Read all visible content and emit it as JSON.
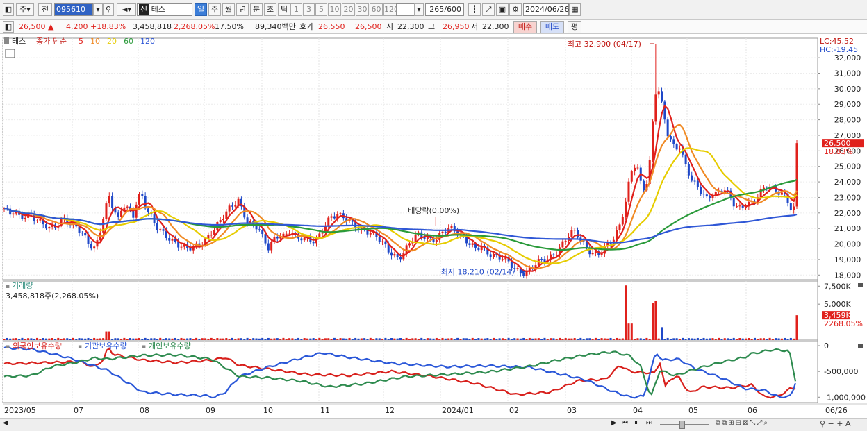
{
  "toolbar": {
    "market": "주",
    "prev_label": "전",
    "code": "095610",
    "stock_name": "테스",
    "stock_badge": "신",
    "periods": [
      "일",
      "주",
      "월",
      "년",
      "분",
      "초",
      "틱"
    ],
    "selected_period": "일",
    "numbers": [
      "1",
      "3",
      "5",
      "10",
      "20",
      "30",
      "60",
      "120"
    ],
    "count": "265",
    "count_total": "/600",
    "date": "2024/06/26"
  },
  "quote": {
    "price": "26,500",
    "change": "4,200",
    "change_pct": "+18.83%",
    "volume": "3,458,818",
    "volume_pct": "2,268.05%",
    "turnover": "17.50%",
    "amount": "89,340백만",
    "bid_label": "호가",
    "ask": "26,550",
    "bid": "26,500",
    "open_label": "시",
    "open": "22,300",
    "high_label": "고",
    "high": "26,950",
    "low_label": "저",
    "low": "22,300",
    "buy_label": "매수",
    "sell_label": "매도",
    "eval_label": "평"
  },
  "price_panel": {
    "stock_label": "테스",
    "legend_title": "종가 단순",
    "ma": [
      {
        "period": "5",
        "color": "#e0211c"
      },
      {
        "period": "10",
        "color": "#f08a24"
      },
      {
        "period": "20",
        "color": "#e6cc00"
      },
      {
        "period": "60",
        "color": "#2a9a3a"
      },
      {
        "period": "120",
        "color": "#2f57d6"
      }
    ],
    "lc": "LC:45.52",
    "hc": "HC:-19.45",
    "high_annotation": "최고 32,900 (04/17)",
    "low_annotation": "최저 18,210 (02/14)",
    "dividend_annotation": "배당락(0.00%)",
    "last_price_tag": "26,500",
    "last_pct_tag": "18.83%",
    "y_ticks": [
      "32,000",
      "31,000",
      "30,000",
      "29,000",
      "28,000",
      "27,000",
      "26,000",
      "25,000",
      "24,000",
      "23,000",
      "22,000",
      "21,000",
      "20,000",
      "19,000",
      "18,000"
    ]
  },
  "volume_panel": {
    "title": "거래량",
    "value": "3,458,818주(2,268.05%)",
    "y_ticks": [
      "7,500K",
      "5,000K"
    ],
    "last_tag": "3,459K",
    "last_pct": "2268.05%"
  },
  "holdings_panel": {
    "series": [
      {
        "name": "외국인보유수량",
        "color": "#d8201c"
      },
      {
        "name": "기관보유수량",
        "color": "#2a57d8"
      },
      {
        "name": "개인보유수량",
        "color": "#2e8b4f"
      }
    ],
    "y_ticks": [
      "0",
      "-500,000",
      "-1,000,000"
    ]
  },
  "x_axis": [
    "2023/05",
    "07",
    "08",
    "09",
    "10",
    "11",
    "12",
    "2024/01",
    "02",
    "03",
    "04",
    "05",
    "06"
  ],
  "x_axis_right": "06/26",
  "chart_data": {
    "type": "candlestick",
    "ylim": [
      17700,
      32900
    ],
    "high": {
      "value": 32900,
      "date": "04/17"
    },
    "low": {
      "value": 18210,
      "date": "02/14"
    },
    "last": 26500,
    "price_path": [
      [
        0,
        22300
      ],
      [
        8,
        21800
      ],
      [
        15,
        22100
      ],
      [
        22,
        21700
      ],
      [
        30,
        21900
      ],
      [
        38,
        22000
      ],
      [
        45,
        21600
      ],
      [
        55,
        21200
      ],
      [
        65,
        21000
      ],
      [
        75,
        21300
      ],
      [
        85,
        21700
      ],
      [
        95,
        21200
      ],
      [
        105,
        21000
      ],
      [
        115,
        20600
      ],
      [
        125,
        20000
      ],
      [
        132,
        19700
      ],
      [
        140,
        21000
      ],
      [
        148,
        22400
      ],
      [
        152,
        23000
      ],
      [
        158,
        22300
      ],
      [
        165,
        21700
      ],
      [
        172,
        22700
      ],
      [
        180,
        22200
      ],
      [
        186,
        21600
      ],
      [
        192,
        22700
      ],
      [
        198,
        23200
      ],
      [
        205,
        22400
      ],
      [
        212,
        21900
      ],
      [
        220,
        21200
      ],
      [
        228,
        20700
      ],
      [
        236,
        20300
      ],
      [
        245,
        20100
      ],
      [
        255,
        20000
      ],
      [
        265,
        19800
      ],
      [
        275,
        19700
      ],
      [
        285,
        19900
      ],
      [
        292,
        20300
      ],
      [
        300,
        20900
      ],
      [
        310,
        21400
      ],
      [
        320,
        21900
      ],
      [
        330,
        22400
      ],
      [
        338,
        22900
      ],
      [
        345,
        22200
      ],
      [
        352,
        21500
      ],
      [
        360,
        21200
      ],
      [
        368,
        20900
      ],
      [
        375,
        20200
      ],
      [
        382,
        19800
      ],
      [
        390,
        20400
      ],
      [
        398,
        20700
      ],
      [
        406,
        20400
      ],
      [
        414,
        20800
      ],
      [
        422,
        20300
      ],
      [
        430,
        20500
      ],
      [
        440,
        20400
      ],
      [
        450,
        20100
      ],
      [
        458,
        20600
      ],
      [
        466,
        21300
      ],
      [
        474,
        21900
      ],
      [
        482,
        22000
      ],
      [
        490,
        21800
      ],
      [
        498,
        21400
      ],
      [
        506,
        21100
      ],
      [
        514,
        20900
      ],
      [
        522,
        21000
      ],
      [
        530,
        20800
      ],
      [
        538,
        20500
      ],
      [
        546,
        20000
      ],
      [
        554,
        19600
      ],
      [
        562,
        19300
      ],
      [
        570,
        19200
      ],
      [
        578,
        19500
      ],
      [
        586,
        20000
      ],
      [
        594,
        20400
      ],
      [
        602,
        20600
      ],
      [
        610,
        20500
      ],
      [
        618,
        20400
      ],
      [
        626,
        20300
      ],
      [
        634,
        20700
      ],
      [
        642,
        20900
      ],
      [
        650,
        21000
      ],
      [
        658,
        20700
      ],
      [
        666,
        20400
      ],
      [
        674,
        19900
      ],
      [
        682,
        19600
      ],
      [
        690,
        19800
      ],
      [
        698,
        19500
      ],
      [
        706,
        19400
      ],
      [
        714,
        19200
      ],
      [
        722,
        19000
      ],
      [
        730,
        18700
      ],
      [
        738,
        18400
      ],
      [
        746,
        18300
      ],
      [
        754,
        18210
      ],
      [
        762,
        18400
      ],
      [
        770,
        18700
      ],
      [
        778,
        18900
      ],
      [
        786,
        19100
      ],
      [
        794,
        19400
      ],
      [
        802,
        19700
      ],
      [
        810,
        20100
      ],
      [
        818,
        20600
      ],
      [
        826,
        20800
      ],
      [
        834,
        20300
      ],
      [
        842,
        19800
      ],
      [
        850,
        19400
      ],
      [
        858,
        19200
      ],
      [
        866,
        19500
      ],
      [
        874,
        20100
      ],
      [
        882,
        20500
      ],
      [
        890,
        21300
      ],
      [
        898,
        22500
      ],
      [
        906,
        24500
      ],
      [
        914,
        25200
      ],
      [
        920,
        24000
      ],
      [
        926,
        23600
      ],
      [
        932,
        24600
      ],
      [
        937,
        27500
      ],
      [
        941,
        29600
      ],
      [
        945,
        30200
      ],
      [
        948,
        29200
      ],
      [
        952,
        28700
      ],
      [
        958,
        27200
      ],
      [
        964,
        26700
      ],
      [
        970,
        26200
      ],
      [
        976,
        26500
      ],
      [
        982,
        25500
      ],
      [
        988,
        24700
      ],
      [
        994,
        24000
      ],
      [
        1000,
        23700
      ],
      [
        1008,
        23400
      ],
      [
        1016,
        23000
      ],
      [
        1024,
        23300
      ],
      [
        1032,
        23200
      ],
      [
        1040,
        23500
      ],
      [
        1048,
        23100
      ],
      [
        1056,
        22600
      ],
      [
        1064,
        22400
      ],
      [
        1072,
        22600
      ],
      [
        1080,
        22500
      ],
      [
        1088,
        22900
      ],
      [
        1096,
        23500
      ],
      [
        1104,
        23900
      ],
      [
        1112,
        23600
      ],
      [
        1120,
        23300
      ],
      [
        1128,
        23000
      ],
      [
        1134,
        22600
      ],
      [
        1138,
        22200
      ],
      [
        1142,
        22300
      ],
      [
        1146,
        26500
      ]
    ],
    "holdings": {
      "foreign": [
        [
          0,
          -350000
        ],
        [
          60,
          -330000
        ],
        [
          110,
          -310000
        ],
        [
          130,
          -420000
        ],
        [
          145,
          -250000
        ],
        [
          150,
          -20000
        ],
        [
          158,
          -170000
        ],
        [
          200,
          -280000
        ],
        [
          250,
          -330000
        ],
        [
          300,
          -280000
        ],
        [
          320,
          -230000
        ],
        [
          340,
          -380000
        ],
        [
          380,
          -450000
        ],
        [
          440,
          -560000
        ],
        [
          500,
          -580000
        ],
        [
          560,
          -500000
        ],
        [
          620,
          -600000
        ],
        [
          680,
          -730000
        ],
        [
          740,
          -950000
        ],
        [
          790,
          -900000
        ],
        [
          830,
          -680000
        ],
        [
          870,
          -650000
        ],
        [
          890,
          -380000
        ],
        [
          905,
          -500000
        ],
        [
          920,
          -520000
        ],
        [
          940,
          -530000
        ],
        [
          948,
          -330000
        ],
        [
          956,
          -800000
        ],
        [
          962,
          -650000
        ],
        [
          975,
          -600000
        ],
        [
          990,
          -920000
        ],
        [
          1010,
          -800000
        ],
        [
          1050,
          -820000
        ],
        [
          1080,
          -760000
        ],
        [
          1100,
          -1000000
        ],
        [
          1120,
          -980000
        ],
        [
          1135,
          -840000
        ],
        [
          1146,
          -820000
        ]
      ],
      "institution": [
        [
          0,
          -40000
        ],
        [
          40,
          -70000
        ],
        [
          70,
          -160000
        ],
        [
          100,
          -260000
        ],
        [
          125,
          -370000
        ],
        [
          150,
          -480000
        ],
        [
          200,
          -900000
        ],
        [
          250,
          -950000
        ],
        [
          290,
          -970000
        ],
        [
          305,
          -1000000
        ],
        [
          320,
          -900000
        ],
        [
          340,
          -600000
        ],
        [
          380,
          -420000
        ],
        [
          430,
          -240000
        ],
        [
          460,
          -140000
        ],
        [
          500,
          -230000
        ],
        [
          560,
          -340000
        ],
        [
          640,
          -410000
        ],
        [
          700,
          -390000
        ],
        [
          760,
          -420000
        ],
        [
          800,
          -540000
        ],
        [
          840,
          -660000
        ],
        [
          880,
          -890000
        ],
        [
          905,
          -1000000
        ],
        [
          925,
          -980000
        ],
        [
          935,
          -480000
        ],
        [
          942,
          -130000
        ],
        [
          952,
          -280000
        ],
        [
          975,
          -260000
        ],
        [
          1000,
          -450000
        ],
        [
          1040,
          -640000
        ],
        [
          1070,
          -830000
        ],
        [
          1100,
          -870000
        ],
        [
          1120,
          -1000000
        ],
        [
          1138,
          -980000
        ],
        [
          1146,
          -620000
        ]
      ],
      "individual": [
        [
          0,
          -600000
        ],
        [
          40,
          -580000
        ],
        [
          70,
          -400000
        ],
        [
          110,
          -310000
        ],
        [
          130,
          -240000
        ],
        [
          150,
          -260000
        ],
        [
          200,
          -190000
        ],
        [
          250,
          -180000
        ],
        [
          300,
          -260000
        ],
        [
          340,
          -600000
        ],
        [
          380,
          -620000
        ],
        [
          430,
          -690000
        ],
        [
          470,
          -800000
        ],
        [
          520,
          -740000
        ],
        [
          580,
          -600000
        ],
        [
          640,
          -560000
        ],
        [
          700,
          -510000
        ],
        [
          760,
          -400000
        ],
        [
          800,
          -280000
        ],
        [
          840,
          -180000
        ],
        [
          880,
          -120000
        ],
        [
          905,
          -200000
        ],
        [
          920,
          -400000
        ],
        [
          935,
          -1000000
        ],
        [
          948,
          -480000
        ],
        [
          970,
          -580000
        ],
        [
          1000,
          -450000
        ],
        [
          1040,
          -310000
        ],
        [
          1070,
          -230000
        ],
        [
          1080,
          -160000
        ],
        [
          1110,
          -80000
        ],
        [
          1135,
          -100000
        ],
        [
          1146,
          -800000
        ]
      ]
    },
    "volume_spikes": [
      [
        150,
        1200000
      ],
      [
        899,
        7600000
      ],
      [
        905,
        2300000
      ],
      [
        938,
        5200000
      ],
      [
        943,
        5500000
      ],
      [
        950,
        1800000
      ],
      [
        1146,
        3459000
      ]
    ]
  }
}
